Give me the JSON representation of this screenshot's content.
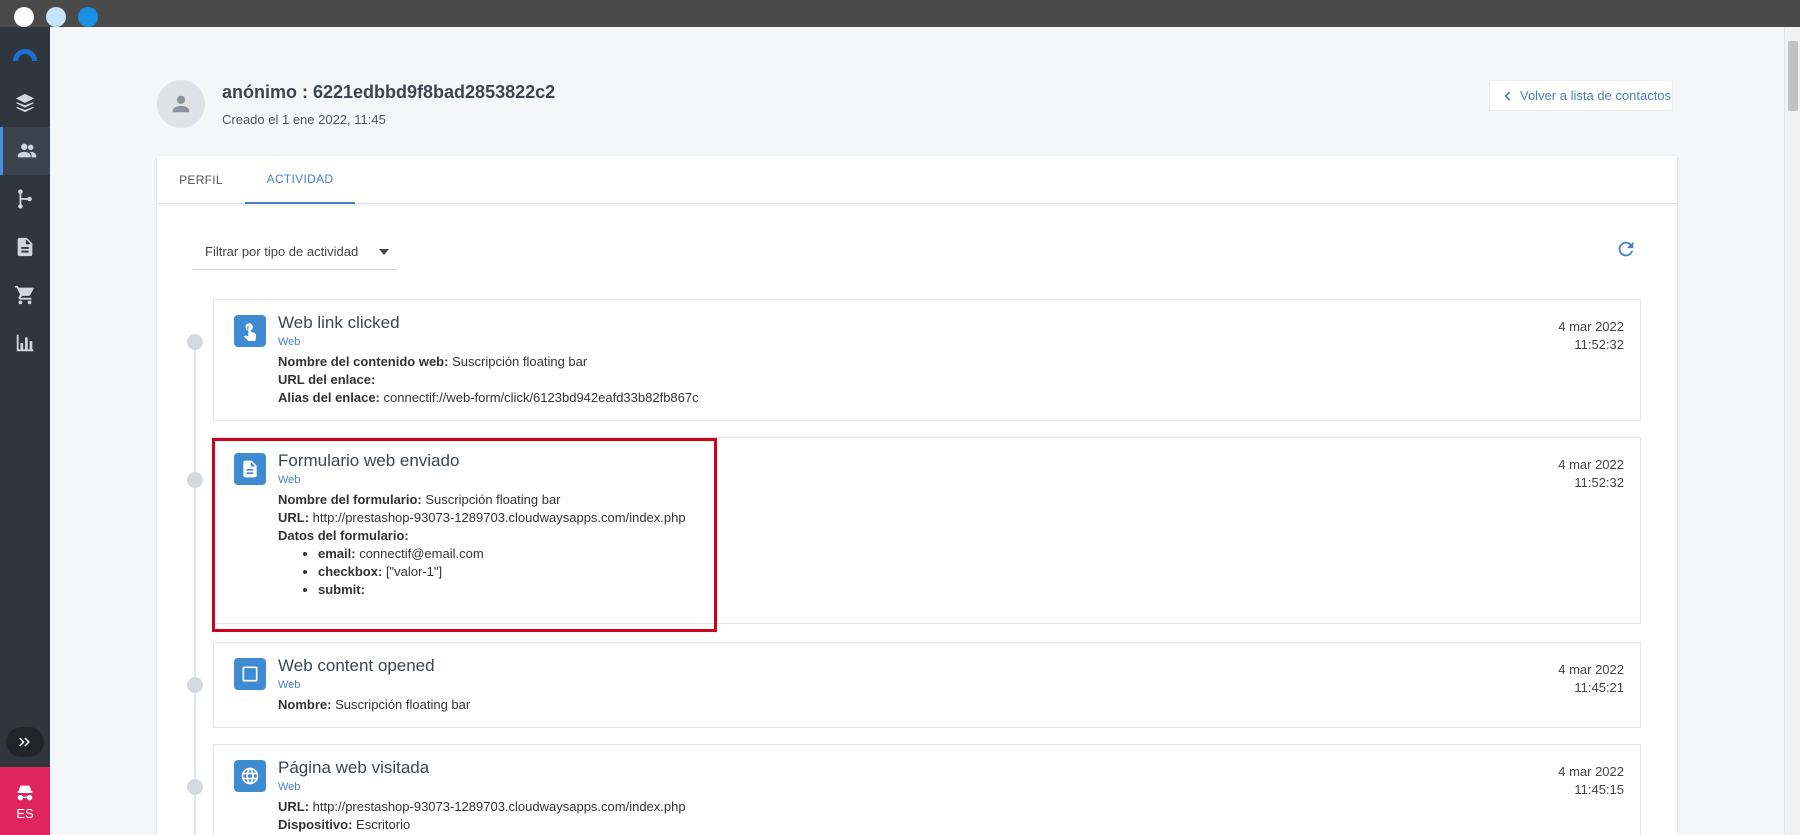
{
  "window": {
    "dots": [
      "close",
      "minimize",
      "maximize"
    ]
  },
  "sidebar": {
    "items": [
      {
        "icon": "layers-icon"
      },
      {
        "icon": "contacts-icon",
        "active": true
      },
      {
        "icon": "workflow-icon"
      },
      {
        "icon": "document-icon"
      },
      {
        "icon": "cart-icon"
      },
      {
        "icon": "bar-chart-icon"
      }
    ],
    "expand_icon": "double-chevron-right-icon",
    "language": "ES"
  },
  "header": {
    "title": "anónimo : 6221edbbd9f8bad2853822c2",
    "created": "Creado el 1 ene 2022, 11:45",
    "back_label": "Volver a lista de contactos"
  },
  "tabs": [
    {
      "label": "PERFIL",
      "active": false
    },
    {
      "label": "ACTIVIDAD",
      "active": true
    }
  ],
  "filter": {
    "label": "Filtrar por tipo de actividad"
  },
  "activities": [
    {
      "title": "Web link clicked",
      "category": "Web",
      "date": "4 mar 2022",
      "time": "11:52:32",
      "icon": "touch-icon",
      "fields": [
        {
          "label": "Nombre del contenido web:",
          "value": "Suscripción floating bar"
        },
        {
          "label": "URL del enlace:",
          "value": ""
        },
        {
          "label": "Alias del enlace:",
          "value": "connectif://web-form/click/6123bd942eafd33b82fb867c"
        }
      ]
    },
    {
      "title": "Formulario web enviado",
      "category": "Web",
      "date": "4 mar 2022",
      "time": "11:52:32",
      "icon": "form-icon",
      "fields": [
        {
          "label": "Nombre del formulario:",
          "value": "Suscripción floating bar"
        },
        {
          "label": "URL:",
          "value": "http://prestashop-93073-1289703.cloudwaysapps.com/index.php"
        },
        {
          "label": "Datos del formulario:",
          "value": ""
        }
      ],
      "form_data": [
        {
          "label": "email:",
          "value": "connectif@email.com"
        },
        {
          "label": "checkbox:",
          "value": "[\"valor-1\"]"
        },
        {
          "label": "submit:",
          "value": ""
        }
      ]
    },
    {
      "title": "Web content opened",
      "category": "Web",
      "date": "4 mar 2022",
      "time": "11:45:21",
      "icon": "square-icon",
      "fields": [
        {
          "label": "Nombre:",
          "value": "Suscripción floating bar"
        }
      ]
    },
    {
      "title": "Página web visitada",
      "category": "Web",
      "date": "4 mar 2022",
      "time": "11:45:15",
      "icon": "globe-icon",
      "fields": [
        {
          "label": "URL:",
          "value": "http://prestashop-93073-1289703.cloudwaysapps.com/index.php"
        },
        {
          "label": "Dispositivo:",
          "value": "Escritorio"
        }
      ]
    }
  ],
  "colors": {
    "accent": "#4a7fc8",
    "icon_bg": "#3f8bd3",
    "highlight": "#d0021b",
    "sidebar": "#2f363d",
    "lang_badge": "#e0245e"
  }
}
